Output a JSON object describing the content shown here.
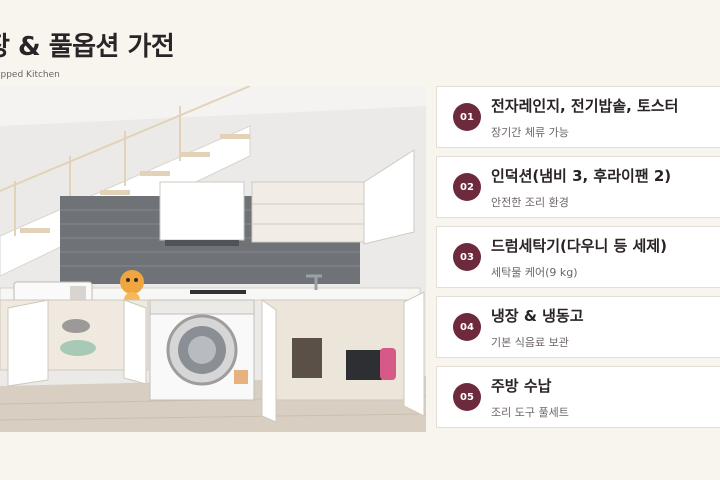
{
  "header": {
    "title": "장 & 풀옵션 가전",
    "subtitle": "ipped Kitchen"
  },
  "photo": {
    "label": ""
  },
  "colors": {
    "accent": "#6e2a3d",
    "background": "#f8f5ee",
    "card": "#ffffff"
  },
  "features": [
    {
      "num": "01",
      "title": "전자레인지, 전기밥솥, 토스터",
      "desc": "장기간 체류 가능"
    },
    {
      "num": "02",
      "title": "인덕션(냄비 3, 후라이팬 2)",
      "desc": "안전한 조리 환경"
    },
    {
      "num": "03",
      "title": "드럼세탁기(다우니 등 세제)",
      "desc": "세탁물 케어(9 kg)"
    },
    {
      "num": "04",
      "title": "냉장 &  냉동고",
      "desc": "기본 식음료 보관"
    },
    {
      "num": "05",
      "title": "주방 수납",
      "desc": "조리 도구 풀세트"
    }
  ]
}
